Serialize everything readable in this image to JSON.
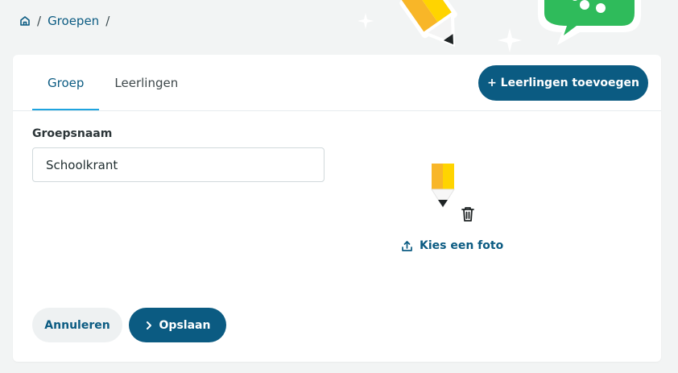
{
  "breadcrumb": {
    "home_icon": "home-icon",
    "items": [
      "Groepen"
    ]
  },
  "tabs": [
    {
      "label": "Groep",
      "active": true
    },
    {
      "label": "Leerlingen",
      "active": false
    }
  ],
  "header_actions": {
    "add_students_label": "+ Leerlingen toevoegen"
  },
  "form": {
    "group_name_label": "Groepsnaam",
    "group_name_value": "Schoolkrant",
    "photo_preview_icon": "pencil-icon",
    "delete_icon": "trash-icon",
    "upload_icon": "upload-icon",
    "choose_photo_label": "Kies een foto"
  },
  "footer": {
    "cancel_label": "Annuleren",
    "save_icon": "chevron-right-icon",
    "save_label": "Opslaan"
  },
  "colors": {
    "primary": "#0b5b82",
    "accent": "#1fa4df",
    "background": "#f2f4f4",
    "card": "#ffffff",
    "pencil_yellow": "#ffd400",
    "pencil_orange": "#f8b628",
    "chat_green": "#2fbb5b"
  }
}
